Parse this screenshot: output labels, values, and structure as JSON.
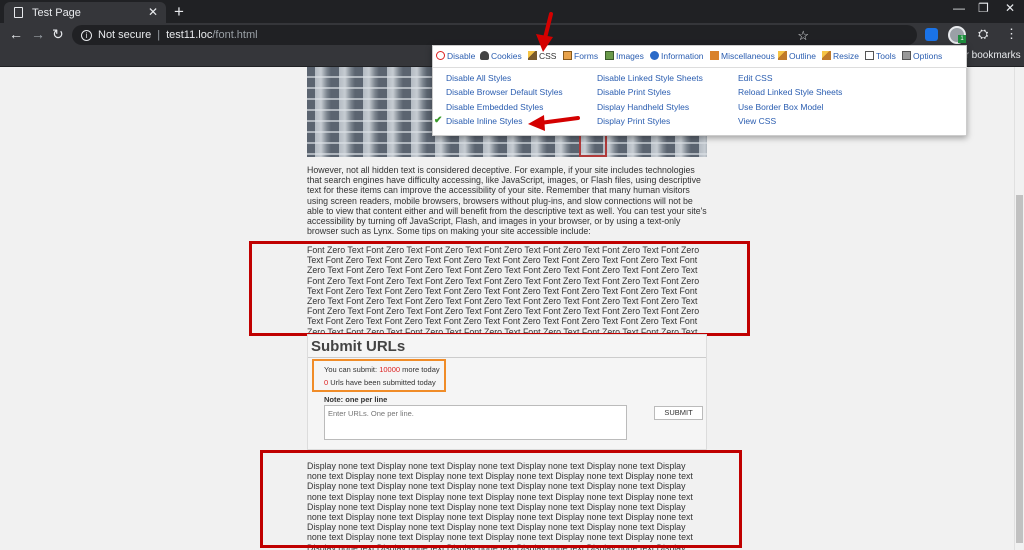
{
  "browser": {
    "tab_title": "Test Page",
    "tab_close": "✕",
    "new_tab": "+",
    "security": "Not secure",
    "separator": "|",
    "url_host": "test11.loc",
    "url_path": "/font.html",
    "bookmarks_other": "er bookmarks",
    "ext_badge": "1"
  },
  "webdev": {
    "menu": [
      {
        "label": "Disable",
        "icon": "disable-icon"
      },
      {
        "label": "Cookies",
        "icon": "cookies-icon"
      },
      {
        "label": "CSS",
        "icon": "css-icon"
      },
      {
        "label": "Forms",
        "icon": "forms-icon"
      },
      {
        "label": "Images",
        "icon": "images-icon"
      },
      {
        "label": "Information",
        "icon": "information-icon"
      },
      {
        "label": "Miscellaneous",
        "icon": "miscellaneous-icon"
      },
      {
        "label": "Outline",
        "icon": "outline-icon"
      },
      {
        "label": "Resize",
        "icon": "resize-icon"
      },
      {
        "label": "Tools",
        "icon": "tools-icon"
      },
      {
        "label": "Options",
        "icon": "options-icon"
      }
    ],
    "css_col1": [
      "Disable All Styles",
      "Disable Browser Default Styles",
      "Disable Embedded Styles",
      "Disable Inline Styles"
    ],
    "css_col2": [
      "Disable Linked Style Sheets",
      "Disable Print Styles",
      "Display Handheld Styles",
      "Display Print Styles"
    ],
    "css_col3": [
      "Edit CSS",
      "Reload Linked Style Sheets",
      "Use Border Box Model",
      "View CSS"
    ]
  },
  "page": {
    "paragraph": "However, not all hidden text is considered deceptive. For example, if your site includes technologies that search engines have difficulty accessing, like JavaScript, images, or Flash files, using descriptive text for these items can improve the accessibility of your site. Remember that many human visitors using screen readers, mobile browsers, browsers without plug-ins, and slow connections will not be able to view that content either and will benefit from the descriptive text as well. You can test your site's accessibility by turning off JavaScript, Flash, and images in your browser, or by using a text-only browser such as Lynx. Some tips on making your site accessible include:",
    "font_zero_text": "Font Zero Text Font Zero Text Font Zero Text Font Zero Text Font Zero Text Font Zero Text Font Zero Text Font Zero Text Font Zero Text Font Zero Text Font Zero Text Font Zero Text Font Zero Text Font Zero Text Font Zero Text Font Zero Text Font Zero Text Font Zero Text Font Zero Text Font Zero Text Font Zero Text Font Zero Text Font Zero Text Font Zero Text Font Zero Text Font Zero Text Font Zero Text Font Zero Text Font Zero Text Font Zero Text Font Zero Text Font Zero Text Font Zero Text Font Zero Text Font Zero Text Font Zero Text Font Zero Text Font Zero Text Font Zero Text Font Zero Text Font Zero Text Font Zero Text Font Zero Text Font Zero Text Font Zero Text Font Zero Text Font Zero Text Font Zero Text Font Zero Text Font Zero Text Font Zero Text Font Zero Text Font Zero Text Font Zero Text Font Zero Text Font Zero Text Font Zero Text Font Zero Text Font Zero Text Font Zero Text Font Zero Text Font Zero Text Font Zero Text Font Zero Text Font Zero Text Font Zero Text Font Zero Text Font Zero Text Font Zero Text Font Zero Text",
    "display_none_text": "Display none text Display none text Display none text Display none text Display none text Display none text Display none text Display none text Display none text Display none text Display none text Display none text Display none text Display none text Display none text Display none text Display none text Display none text Display none text Display none text Display none text Display none text Display none text Display none text Display none text Display none text Display none text Display none text Display none text Display none text Display none text Display none text Display none text Display none text Display none text Display none text Display none text Display none text Display none text Display none text Display none text Display none text Display none text Display none text Display none text Display none text Display none text Display none text Display none text Display none text Display none text Display none text Display none text Display none text Display none text Display none text Display none text Display none text"
  },
  "submit": {
    "title": "Submit URLs",
    "quota_prefix": "You can submit: ",
    "quota_value": "10000",
    "quota_suffix": " more today",
    "submitted_value": "0",
    "submitted_suffix": " Urls have been submitted today",
    "note": "Note: one per line",
    "placeholder": "Enter URLs. One per line.",
    "button": "SUBMIT"
  },
  "colors": {
    "highlight_box": "#c00000",
    "quota_box": "#f08c28",
    "link": "#2a5db0",
    "chrome_dark": "#202124"
  }
}
